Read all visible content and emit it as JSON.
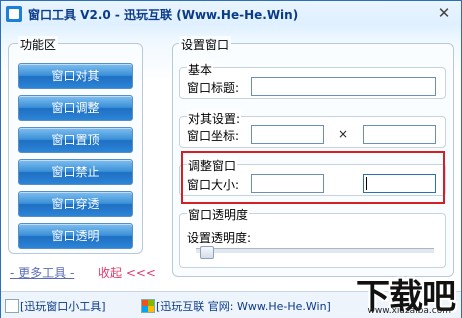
{
  "window": {
    "title": "窗口工具 V2.0 - 迅玩互联 (Www.He-He.Win)",
    "close_glyph": "✕"
  },
  "left_panel": {
    "title": "功能区",
    "buttons": [
      "窗口对其",
      "窗口调整",
      "窗口置顶",
      "窗口禁止",
      "窗口穿透",
      "窗口透明"
    ],
    "more_tools": "- 更多工具 -",
    "collapse": "收起 <<<"
  },
  "right_panel": {
    "title": "设置窗口",
    "basic": {
      "title": "基本",
      "window_title_label": "窗口标题:",
      "window_title_value": ""
    },
    "align": {
      "title": "对其设置:",
      "coord_label": "窗口坐标:",
      "x_value": "",
      "times": "×",
      "y_value": ""
    },
    "resize": {
      "title": "调整窗口",
      "size_label": "窗口大小:",
      "w_value": "",
      "times": "×",
      "h_value": ""
    },
    "opacity": {
      "title": "窗口透明度",
      "label": "设置透明度:",
      "level": 0
    }
  },
  "statusbar": {
    "item1": "[迅玩窗口小工具]",
    "item2": "[迅玩互联 官网: Www.He-He.Win]"
  },
  "watermark": {
    "text": "下载吧",
    "url": "www.xiazaiba.com"
  },
  "colors": {
    "accent": "#2c85d6",
    "highlight_border": "#d61e25",
    "link": "#5a6cb8",
    "link_red": "#e23a6a"
  }
}
